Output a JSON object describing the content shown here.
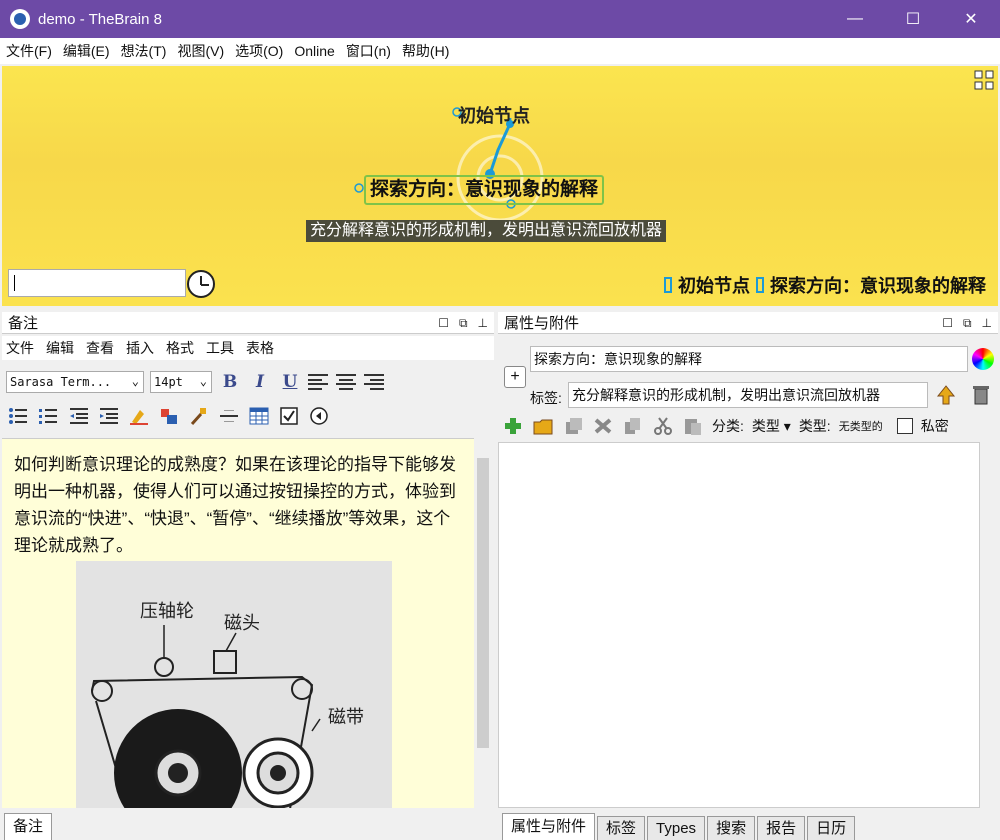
{
  "window": {
    "title": "demo - TheBrain 8",
    "min": "—",
    "max": "☐",
    "close": "✕"
  },
  "menubar": [
    "文件(F)",
    "编辑(E)",
    "想法(T)",
    "视图(V)",
    "选项(O)",
    "Online",
    "窗口(n)",
    "帮助(H)"
  ],
  "plex": {
    "parent_node": "初始节点",
    "active_node": "探索方向：意识现象的解释",
    "active_node_label": "充分解释意识的形成机制，发明出意识流回放机器",
    "search_value": "",
    "pins": [
      "初始节点",
      "探索方向：意识现象的解释"
    ],
    "accent": "#7fc348",
    "link_color": "#1c9ad6"
  },
  "notes_panel": {
    "title": "备注",
    "menu": [
      "文件",
      "编辑",
      "查看",
      "插入",
      "格式",
      "工具",
      "表格"
    ],
    "font_family": "Sarasa Term...",
    "font_size": "14pt",
    "bold": "B",
    "italic": "I",
    "underline": "U",
    "body_text": "如何判断意识理论的成熟度？如果在该理论的指导下能够发明出一种机器，使得人们可以通过按钮操控的方式，体验到意识流的“快进”、“快退”、“暂停”、“继续播放”等效果，这个理论就成熟了。",
    "figure_labels": {
      "pinch_roller": "压轴轮",
      "head": "磁头",
      "tape": "磁带"
    },
    "tabs": [
      "备注"
    ]
  },
  "props_panel": {
    "title": "属性与附件",
    "name_value": "探索方向：意识现象的解释",
    "label_caption": "标签:",
    "label_value": "充分解释意识的形成机制，发明出意识流回放机器",
    "category_caption": "分类:",
    "category_value": "类型",
    "type_caption": "类型:",
    "type_value": "无类型的",
    "private_caption": "私密",
    "tabs": [
      "属性与附件",
      "标签",
      "Types",
      "搜索",
      "报告",
      "日历"
    ]
  }
}
